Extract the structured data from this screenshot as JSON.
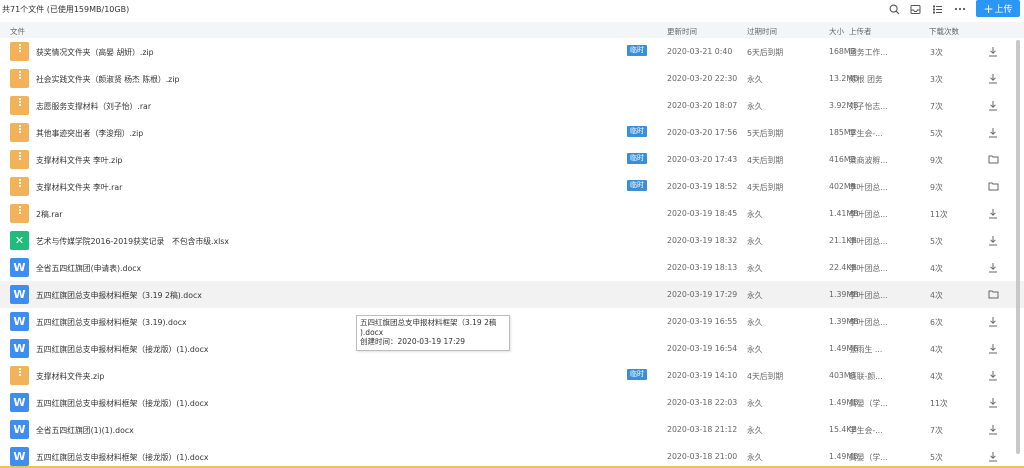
{
  "toolbar": {
    "summary": "共71个文件 (已使用159MB/10GB)",
    "icons": [
      "search-icon",
      "inbox-icon",
      "list-view-icon",
      "more-icon"
    ],
    "upload_plus": "+",
    "upload_label": "上传",
    "accent": "#2a97f6"
  },
  "columns": {
    "file": "文件",
    "updated": "更新时间",
    "expires": "过期时间",
    "size": "大小",
    "uploader": "上传者",
    "downloads": "下载次数"
  },
  "files": [
    {
      "type": "zip",
      "name": "获奖情况文件夹（高晏 胡妍）.zip",
      "temp": "临时",
      "time": "2020-03-21 0:40",
      "expires": "6天后到期",
      "size": "168MB",
      "uploader": "团务工作...",
      "downloads": "3次",
      "action": "download-icon"
    },
    {
      "type": "zip",
      "name": "社会实践文件夹（颜淑贤 杨杰 陈根）.zip",
      "temp": "",
      "time": "2020-03-20 22:30",
      "expires": "永久",
      "size": "13.2MB",
      "uploader": "陈根 团务",
      "downloads": "3次",
      "action": "download-icon"
    },
    {
      "type": "zip",
      "name": "志愿服务支撑材料（刘子怡）.rar",
      "temp": "",
      "time": "2020-03-20 18:07",
      "expires": "永久",
      "size": "3.92MB",
      "uploader": "刘子怡志...",
      "downloads": "7次",
      "action": "download-icon"
    },
    {
      "type": "zip",
      "name": "其他事迹突出者（李浚翔）.zip",
      "temp": "临时",
      "time": "2020-03-20 17:56",
      "expires": "5天后到期",
      "size": "185MB",
      "uploader": "学生会-...",
      "downloads": "5次",
      "action": "download-icon"
    },
    {
      "type": "zip",
      "name": "支撑材料文件夹 李叶.zip",
      "temp": "临时",
      "time": "2020-03-20 17:43",
      "expires": "4天后到期",
      "size": "416MB",
      "uploader": "梁商波孵...",
      "downloads": "9次",
      "action": "folder-icon"
    },
    {
      "type": "zip",
      "name": "支撑材料文件夹 李叶.rar",
      "temp": "临时",
      "time": "2020-03-19 18:52",
      "expires": "4天后到期",
      "size": "402MB",
      "uploader": "李叶团总...",
      "downloads": "9次",
      "action": "folder-icon"
    },
    {
      "type": "zip",
      "name": "2稿.rar",
      "temp": "",
      "time": "2020-03-19 18:45",
      "expires": "永久",
      "size": "1.41MB",
      "uploader": "李叶团总...",
      "downloads": "11次",
      "action": "download-icon"
    },
    {
      "type": "xlsx",
      "name": "艺术与传媒学院2016-2019获奖记录　不包含市级.xlsx",
      "temp": "",
      "time": "2020-03-19 18:32",
      "expires": "永久",
      "size": "21.1KB",
      "uploader": "李叶团总...",
      "downloads": "5次",
      "action": "download-icon"
    },
    {
      "type": "docx",
      "name": "全省五四红旗团(申请表).docx",
      "temp": "",
      "time": "2020-03-19 18:13",
      "expires": "永久",
      "size": "22.4KB",
      "uploader": "李叶团总...",
      "downloads": "4次",
      "action": "download-icon"
    },
    {
      "type": "docx",
      "name": "五四红旗团总支申报材料框架（3.19 2稿).docx",
      "temp": "",
      "time": "2020-03-19 17:29",
      "expires": "永久",
      "size": "1.39MB",
      "uploader": "李叶团总...",
      "downloads": "4次",
      "action": "folder-icon"
    },
    {
      "type": "docx",
      "name": "五四红旗团总支申报材料框架（3.19).docx",
      "temp": "",
      "time": "2020-03-19 16:55",
      "expires": "永久",
      "size": "1.39MB",
      "uploader": "李叶团总...",
      "downloads": "6次",
      "action": "download-icon"
    },
    {
      "type": "docx",
      "name": "五四红旗团总支申报材料框架（接龙版）(1).docx",
      "temp": "",
      "time": "2020-03-19 16:54",
      "expires": "永久",
      "size": "1.49MB",
      "uploader": "张雨生 ...",
      "downloads": "4次",
      "action": "download-icon"
    },
    {
      "type": "zip",
      "name": "支撑材料文件夹.zip",
      "temp": "临时",
      "time": "2020-03-19 14:10",
      "expires": "4天后到期",
      "size": "403MB",
      "uploader": "班联-颜...",
      "downloads": "4次",
      "action": "download-icon"
    },
    {
      "type": "docx",
      "name": "五四红旗团总支申报材料框架（接龙版）(1).docx",
      "temp": "",
      "time": "2020-03-18 22:03",
      "expires": "永久",
      "size": "1.49MB",
      "uploader": "高晏（学...",
      "downloads": "11次",
      "action": "download-icon"
    },
    {
      "type": "docx",
      "name": "全省五四红旗团(1)(1).docx",
      "temp": "",
      "time": "2020-03-18 21:12",
      "expires": "永久",
      "size": "15.4KB",
      "uploader": "学生会-...",
      "downloads": "7次",
      "action": "download-icon"
    },
    {
      "type": "docx",
      "name": "五四红旗团总支申报材料框架（接龙版）(1).docx",
      "temp": "",
      "time": "2020-03-18 21:00",
      "expires": "永久",
      "size": "1.49MB",
      "uploader": "高晏（学...",
      "downloads": "5次",
      "action": "download-icon"
    }
  ],
  "tooltip": {
    "line1": "五四红旗团总支申报材料框架（3.19 2稿",
    "line2": ").docx",
    "line3": "创建时间：2020-03-19 17:29"
  }
}
